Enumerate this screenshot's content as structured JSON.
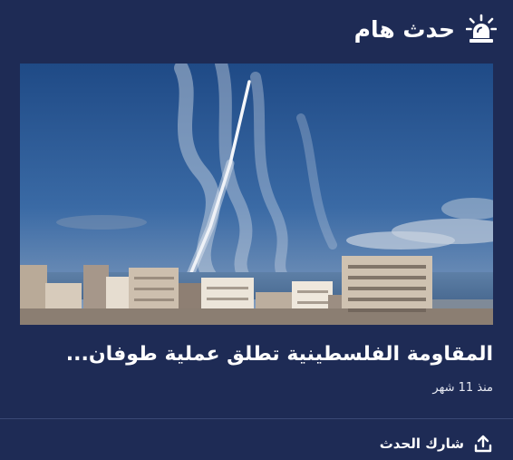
{
  "widget": {
    "title": "حدث هام",
    "icon": "siren-icon"
  },
  "article": {
    "image_alt": "rockets-launch-over-gaza-buildings",
    "headline": "المقاومة الفلسطينية تطلق عملية طوفان...",
    "time_ago": "منذ 11 شهر"
  },
  "footer": {
    "share_label": "شارك الحدث",
    "share_icon": "share-icon"
  },
  "colors": {
    "background": "#1e2b55",
    "text": "#ffffff",
    "divider": "#3a4875"
  }
}
